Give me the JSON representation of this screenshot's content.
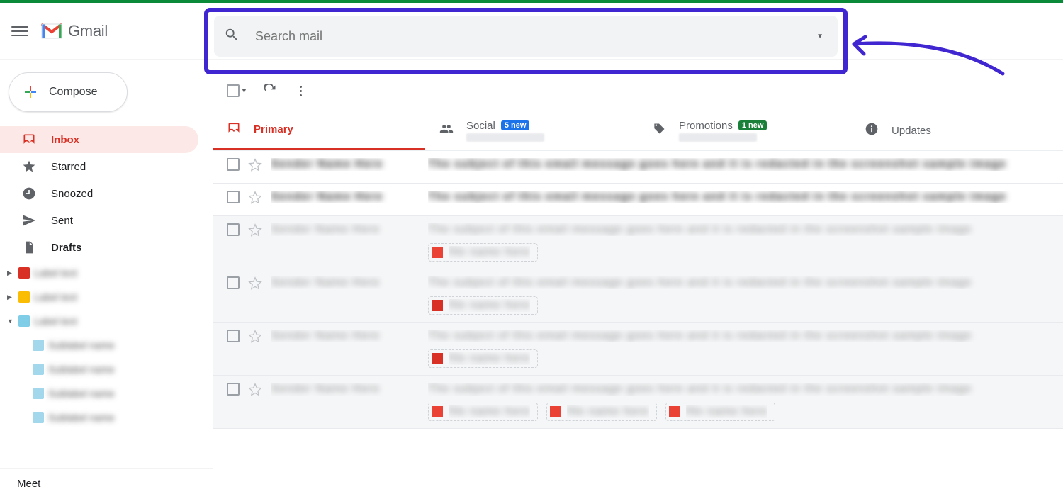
{
  "header": {
    "app_name": "Gmail",
    "search_placeholder": "Search mail"
  },
  "sidebar": {
    "compose_label": "Compose",
    "nav": [
      {
        "label": "Inbox",
        "icon": "inbox",
        "active": true
      },
      {
        "label": "Starred",
        "icon": "star"
      },
      {
        "label": "Snoozed",
        "icon": "clock"
      },
      {
        "label": "Sent",
        "icon": "send"
      },
      {
        "label": "Drafts",
        "icon": "file",
        "bold": true
      }
    ],
    "labels": [
      {
        "color": "#d93025"
      },
      {
        "color": "#fbbc04"
      },
      {
        "color": "#80cde8",
        "expanded": true,
        "children": [
          {
            "color": "#a3d7ec"
          },
          {
            "color": "#a3d7ec"
          },
          {
            "color": "#a3d7ec"
          },
          {
            "color": "#a3d7ec"
          }
        ]
      }
    ],
    "meet_label": "Meet"
  },
  "tabs": [
    {
      "key": "primary",
      "label": "Primary",
      "active": true
    },
    {
      "key": "social",
      "label": "Social",
      "badge": "5 new",
      "badge_style": "blue"
    },
    {
      "key": "promotions",
      "label": "Promotions",
      "badge": "1 new",
      "badge_style": "green"
    },
    {
      "key": "updates",
      "label": "Updates"
    }
  ],
  "rows": [
    {
      "unread": true,
      "chips": []
    },
    {
      "unread": true,
      "chips": []
    },
    {
      "unread": false,
      "chips": [
        {
          "color": "red"
        }
      ]
    },
    {
      "unread": false,
      "chips": [
        {
          "color": "red2"
        }
      ]
    },
    {
      "unread": false,
      "chips": [
        {
          "color": "red2"
        }
      ]
    },
    {
      "unread": false,
      "chips": [
        {
          "color": "red"
        },
        {
          "color": "red"
        },
        {
          "color": "red"
        }
      ]
    }
  ]
}
